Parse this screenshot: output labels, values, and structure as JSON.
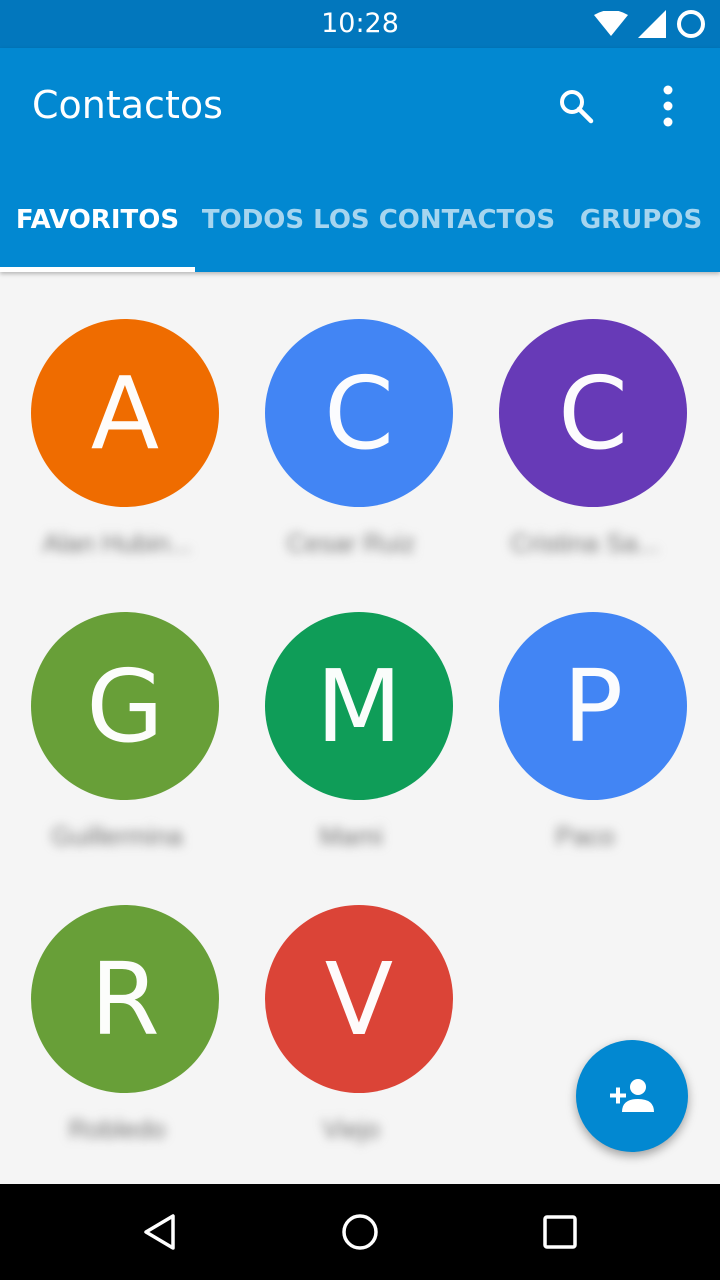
{
  "status_bar": {
    "time": "10:28"
  },
  "app_bar": {
    "title": "Contactos"
  },
  "tabs": [
    {
      "label": "FAVORITOS",
      "active": true
    },
    {
      "label": "TODOS LOS CONTACTOS",
      "active": false
    },
    {
      "label": "GRUPOS",
      "active": false
    }
  ],
  "favorites": [
    {
      "letter": "A",
      "name": "Alan Hubin...",
      "color": "#ef6c00"
    },
    {
      "letter": "C",
      "name": "Cesar Ruiz",
      "color": "#4285f4"
    },
    {
      "letter": "C",
      "name": "Cristina Sa...",
      "color": "#673ab7"
    },
    {
      "letter": "G",
      "name": "Guillermina",
      "color": "#689f38"
    },
    {
      "letter": "M",
      "name": "Mami",
      "color": "#0f9d58"
    },
    {
      "letter": "P",
      "name": "Paco",
      "color": "#4285f4"
    },
    {
      "letter": "R",
      "name": "Robledo",
      "color": "#689f38"
    },
    {
      "letter": "V",
      "name": "Viejo",
      "color": "#db4437"
    }
  ],
  "icons": {
    "search": "search-icon",
    "more": "more-vert-icon",
    "fab": "add-person-icon",
    "back": "back-icon",
    "home": "home-icon",
    "recents": "recents-icon"
  },
  "colors": {
    "primary": "#0288d1",
    "primary_dark": "#0277bd",
    "background": "#f5f5f5"
  }
}
